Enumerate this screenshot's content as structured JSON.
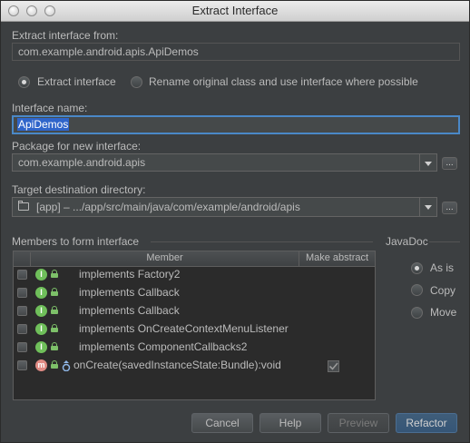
{
  "window": {
    "title": "Extract Interface"
  },
  "extract_from": {
    "label": "Extract interface from:",
    "value": "com.example.android.apis.ApiDemos"
  },
  "mode_options": {
    "extract": {
      "label": "Extract interface",
      "selected": true
    },
    "rename": {
      "label": "Rename original class and use interface where possible",
      "selected": false
    }
  },
  "interface_name": {
    "label": "Interface name:",
    "value": "ApiDemos"
  },
  "package": {
    "label": "Package for new interface:",
    "value": "com.example.android.apis",
    "browse_label": "..."
  },
  "target_dir": {
    "label": "Target destination directory:",
    "value": "[app] – .../app/src/main/java/com/example/android/apis",
    "browse_label": "..."
  },
  "members": {
    "label": "Members to form interface",
    "columns": [
      "Member",
      "Make abstract"
    ],
    "rows": [
      {
        "icon": "I",
        "text": "implements Factory2"
      },
      {
        "icon": "I",
        "text": "implements Callback"
      },
      {
        "icon": "I",
        "text": "implements Callback"
      },
      {
        "icon": "I",
        "text": "implements OnCreateContextMenuListener"
      },
      {
        "icon": "I",
        "text": "implements ComponentCallbacks2"
      },
      {
        "icon": "m",
        "text": "onCreate(savedInstanceState:Bundle):void",
        "make_abstract": true
      }
    ]
  },
  "javadoc": {
    "label": "JavaDoc",
    "options": [
      {
        "label": "As is",
        "selected": true
      },
      {
        "label": "Copy",
        "selected": false
      },
      {
        "label": "Move",
        "selected": false
      }
    ]
  },
  "buttons": {
    "cancel": "Cancel",
    "help": "Help",
    "preview": "Preview",
    "refactor": "Refactor"
  }
}
